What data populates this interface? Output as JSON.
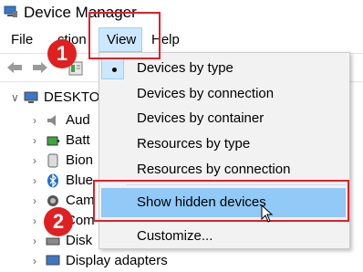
{
  "window": {
    "title": "Device Manager",
    "icon": "device-manager-icon"
  },
  "menubar": {
    "file": "File",
    "action": "ction",
    "view": "View",
    "help": "Help"
  },
  "toolbar": {
    "icons": [
      "back-arrow-icon",
      "forward-arrow-icon",
      "properties-icon"
    ]
  },
  "tree": {
    "root": "DESKTO",
    "items": [
      {
        "label": "Aud",
        "icon": "audio-icon"
      },
      {
        "label": "Batt",
        "icon": "battery-icon"
      },
      {
        "label": "Bion",
        "icon": "biometric-icon"
      },
      {
        "label": "Blue",
        "icon": "bluetooth-icon"
      },
      {
        "label": "Cam",
        "icon": "camera-icon"
      },
      {
        "label": "Com",
        "icon": "computer-icon"
      },
      {
        "label": "Disk",
        "icon": "disk-icon"
      },
      {
        "label": "Display adapters",
        "icon": "display-icon"
      }
    ]
  },
  "view_menu": {
    "items": [
      {
        "label": "Devices by type",
        "selected": true
      },
      {
        "label": "Devices by connection"
      },
      {
        "label": "Devices by container"
      },
      {
        "label": "Resources by type"
      },
      {
        "label": "Resources by connection"
      },
      {
        "label": "Show hidden devices",
        "highlighted": true
      },
      {
        "label": "Customize..."
      }
    ]
  },
  "annotations": {
    "step1": "1",
    "step2": "2",
    "color": "#e0202a"
  }
}
